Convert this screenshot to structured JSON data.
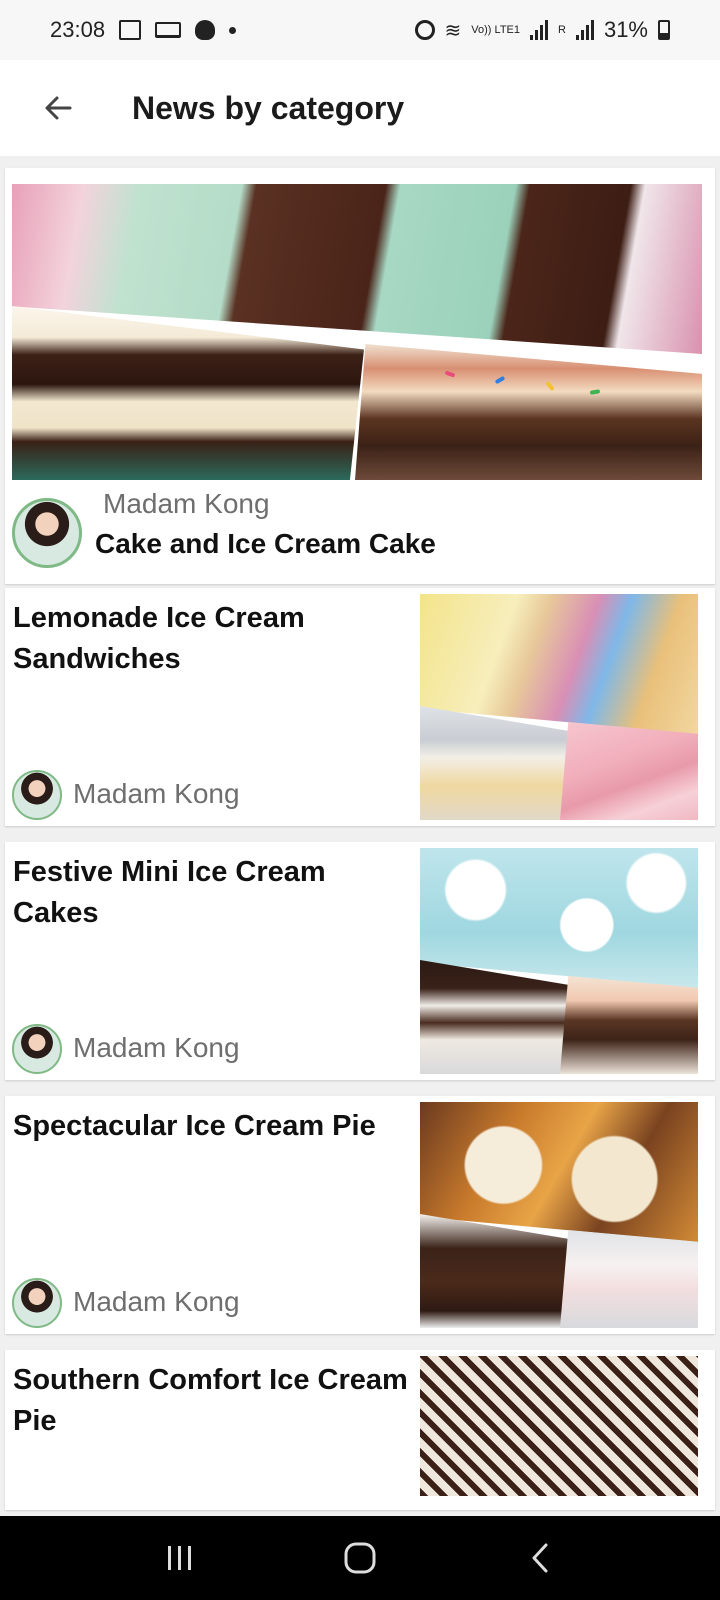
{
  "status_bar": {
    "time": "23:08",
    "network_label": "Vo)) LTE1",
    "sim_label": "R",
    "battery": "31%",
    "icons": [
      "gallery-icon",
      "laptop-icon",
      "bug-icon",
      "dot-icon",
      "alarm-icon",
      "wifi-icon",
      "signal-icon",
      "signal-icon",
      "battery-icon"
    ]
  },
  "app_bar": {
    "back_icon": "arrow-left-icon",
    "title": "News by category"
  },
  "featured": {
    "author": "Madam Kong",
    "title": "Cake and Ice Cream Cake"
  },
  "articles": [
    {
      "title": "Lemonade Ice Cream Sandwiches",
      "author": "Madam Kong"
    },
    {
      "title": "Festive Mini Ice Cream Cakes",
      "author": "Madam Kong"
    },
    {
      "title": "Spectacular Ice Cream Pie",
      "author": "Madam Kong"
    },
    {
      "title": "Southern Comfort Ice Cream Pie",
      "author": ""
    }
  ],
  "nav_bar": {
    "icons": [
      "recent-apps-icon",
      "home-icon",
      "back-icon"
    ]
  }
}
